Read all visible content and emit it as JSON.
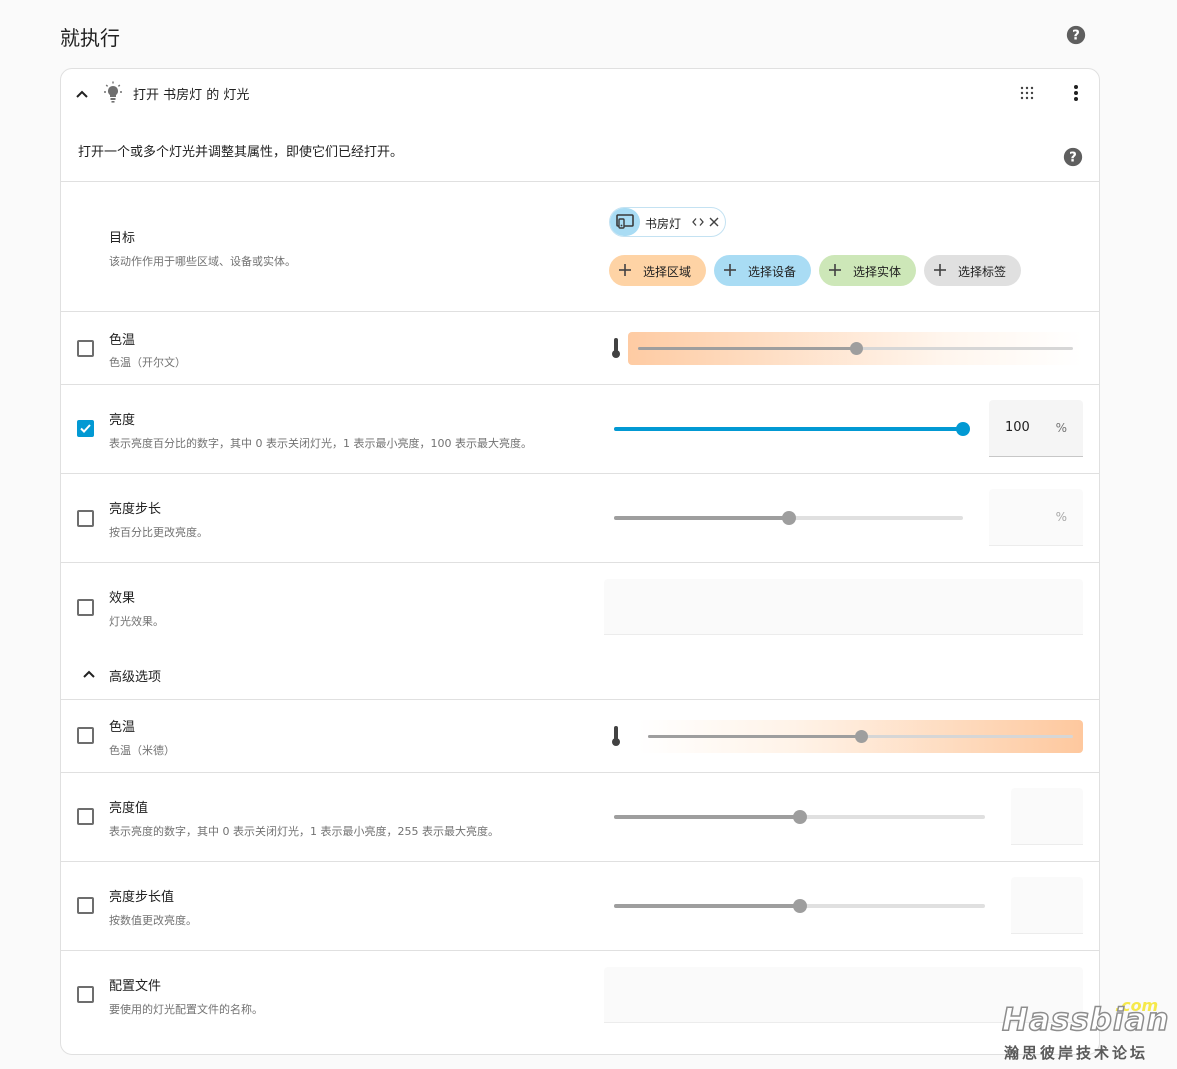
{
  "section": {
    "title": "就执行",
    "help_icon": "help-circle-icon"
  },
  "action": {
    "title": "打开 书房灯 的 灯光",
    "icon": "lightbulb-icon",
    "description": "打开一个或多个灯光并调整其属性，即使它们已经打开。"
  },
  "target": {
    "label": "目标",
    "description": "该动作作用于哪些区域、设备或实体。",
    "entity_chip": "书房灯",
    "add_buttons": {
      "area": "选择区域",
      "device": "选择设备",
      "entity": "选择实体",
      "label": "选择标签"
    }
  },
  "fields": {
    "color_temp_kelvin": {
      "label": "色温",
      "description": "色温（开尔文）",
      "checked": false,
      "slider_value": 0.5
    },
    "brightness_pct": {
      "label": "亮度",
      "description": "表示亮度百分比的数字，其中 0 表示关闭灯光，1 表示最小亮度，100 表示最大亮度。",
      "checked": true,
      "value": "100",
      "unit": "%",
      "slider_value": 1.0
    },
    "brightness_step_pct": {
      "label": "亮度步长",
      "description": "按百分比更改亮度。",
      "checked": false,
      "value": "",
      "unit": "%",
      "slider_value": 0.5
    },
    "effect": {
      "label": "效果",
      "description": "灯光效果。",
      "checked": false,
      "value": ""
    }
  },
  "advanced": {
    "label": "高级选项",
    "fields": {
      "color_temp_mired": {
        "label": "色温",
        "description": "色温（米德）",
        "checked": false,
        "slider_value": 0.5
      },
      "brightness": {
        "label": "亮度值",
        "description": "表示亮度的数字，其中 0 表示关闭灯光，1 表示最小亮度，255 表示最大亮度。",
        "checked": false,
        "value": "",
        "slider_value": 0.5
      },
      "brightness_step": {
        "label": "亮度步长值",
        "description": "按数值更改亮度。",
        "checked": false,
        "value": "",
        "slider_value": 0.5
      },
      "profile": {
        "label": "配置文件",
        "description": "要使用的灯光配置文件的名称。",
        "checked": false,
        "value": ""
      }
    }
  },
  "watermark": {
    "com": ".com",
    "name": "Hassbian",
    "subtitle": "瀚思彼岸技术论坛"
  },
  "colors": {
    "accent": "#0299d3",
    "area_chip": "#fed3a5",
    "device_chip": "#a9dcf4",
    "entity_chip": "#cde7b8",
    "label_chip": "#e0e0e0"
  }
}
